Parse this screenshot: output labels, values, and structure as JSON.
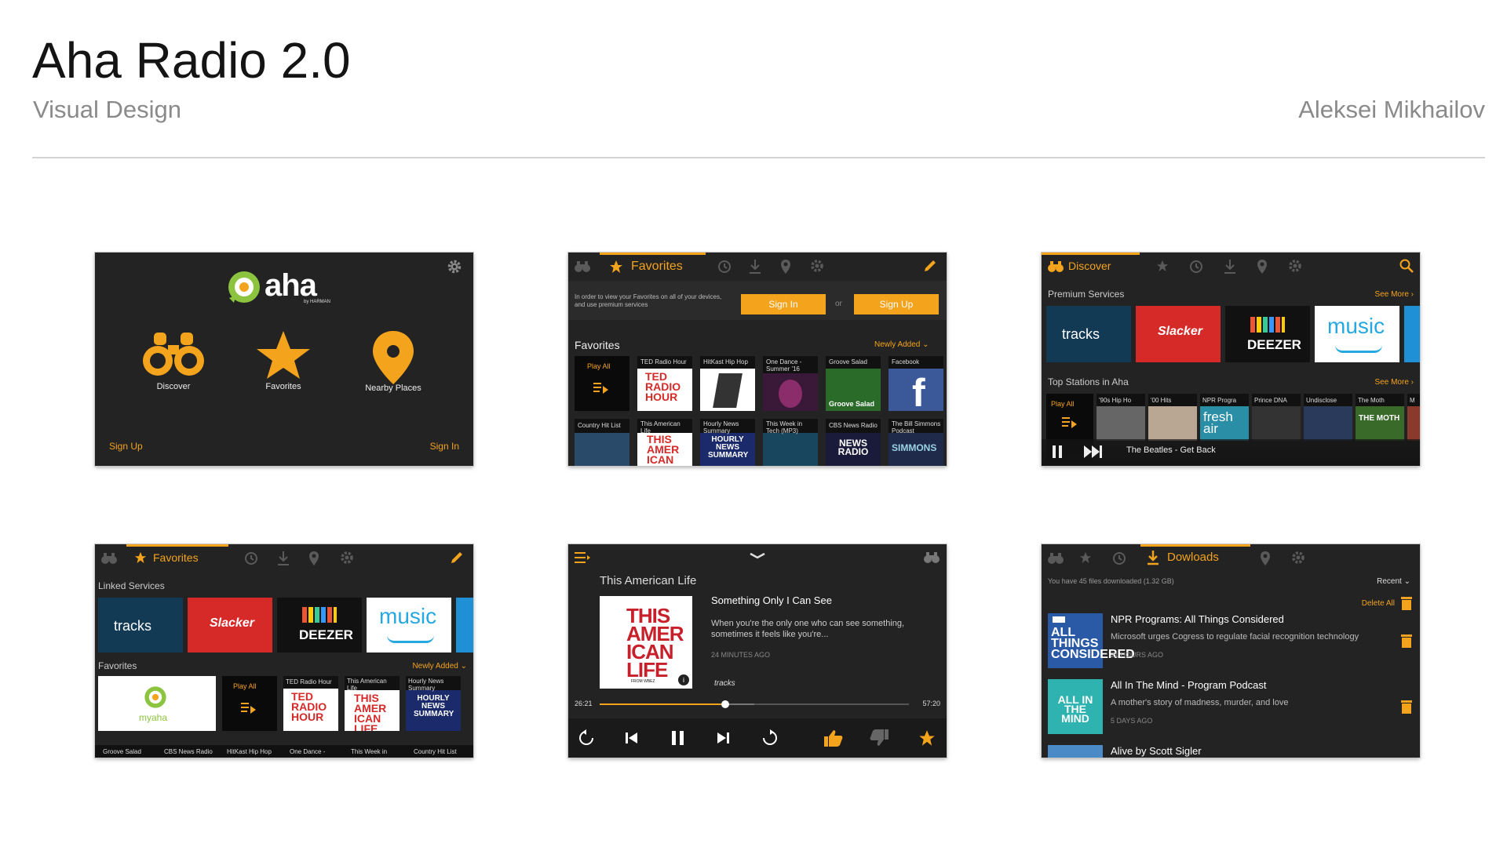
{
  "header": {
    "title": "Aha Radio 2.0",
    "subtitle": "Visual Design",
    "author": "Aleksei Mikhailov"
  },
  "colors": {
    "accent": "#f4a31d",
    "screen_bg": "#232323",
    "tracks": "#123a55",
    "slacker": "#d62a28",
    "deezer": "#111111",
    "amazon": "#ffffff"
  },
  "s1": {
    "logo": "aha",
    "brand": "by HARMAN",
    "items": [
      "Discover",
      "Favorites",
      "Nearby Places"
    ],
    "signup": "Sign Up",
    "signin": "Sign In"
  },
  "s2": {
    "tab": "Favorites",
    "notice": "In order to view your Favorites on all of your devices, and use premium services",
    "signin": "Sign In",
    "or": "or",
    "signup": "Sign Up",
    "section": "Favorites",
    "sort": "Newly Added",
    "play_all": "Play All",
    "row1": [
      "TED Radio Hour",
      "HitKast Hip Hop",
      "One Dance - Summer '16",
      "Groove Salad",
      "Facebook"
    ],
    "row2": [
      "Country Hit List",
      "This American Life",
      "Hourly News Summary",
      "This Week in Tech (MP3)",
      "CBS News Radio",
      "The Bill Simmons Podcast"
    ],
    "art": {
      "ted": "TED RADIO HOUR",
      "groove": "Groove Salad",
      "american": "THIS AMER ICAN LIFE",
      "hourly": "HOURLY NEWS SUMMARY",
      "cbs": "NEWS RADIO",
      "simmons": "SIMMONS"
    }
  },
  "s3": {
    "tab": "Discover",
    "premium": "Premium Services",
    "see_more": "See More",
    "services": [
      "tracks",
      "Slacker",
      "DEEZER",
      "music"
    ],
    "top": "Top Stations in Aha",
    "play_all": "Play All",
    "stations": [
      "'90s Hip Ho",
      "'00 Hits",
      "NPR Progra",
      "Prince DNA",
      "Undisclose",
      "The Moth",
      "M"
    ],
    "fresh": "fresh air",
    "moth": "THE MOTH",
    "now_playing": "The Beatles - Get Back"
  },
  "s4": {
    "tab": "Favorites",
    "linked": "Linked Services",
    "services": [
      "tracks",
      "Slacker",
      "DEEZER",
      "music"
    ],
    "section": "Favorites",
    "sort": "Newly Added",
    "myaha": "myaha",
    "play_all": "Play All",
    "tiles": [
      "TED Radio Hour",
      "This American Life",
      "Hourly News Summary"
    ],
    "bottom": [
      "Groove Salad",
      "CBS News Radio",
      "HitKast Hip Hop",
      "One Dance -",
      "This Week in",
      "Country Hit List"
    ]
  },
  "s5": {
    "station": "This American Life",
    "episode": "Something Only I Can See",
    "desc": "When you're the only one who can see something, sometimes it feels like you're...",
    "age": "24 MINUTES AGO",
    "source": "tracks",
    "art_text": "THIS AMER ICAN LIFE",
    "art_sub": "FROM WBEZ",
    "elapsed": "26:21",
    "total": "57:20",
    "progress": 0.407
  },
  "s6": {
    "tab": "Dowloads",
    "info": "You have 45 files downloaded (1.32 GB)",
    "sort": "Recent",
    "delete_all": "Delete All",
    "items": [
      {
        "title": "NPR Programs: All Things Considered",
        "desc": "Microsoft urges Cogress to regulate facial recognition technology",
        "age": "21 HOURS AGO",
        "art": "ALL THINGS CONSIDERED"
      },
      {
        "title": "All In The Mind - Program Podcast",
        "desc": "A mother's story of madness, murder, and love",
        "age": "5 DAYS AGO",
        "art": "ALL IN THE MIND"
      },
      {
        "title": "Alive by Scott Sigler",
        "desc": "",
        "age": "",
        "art": ""
      }
    ]
  }
}
